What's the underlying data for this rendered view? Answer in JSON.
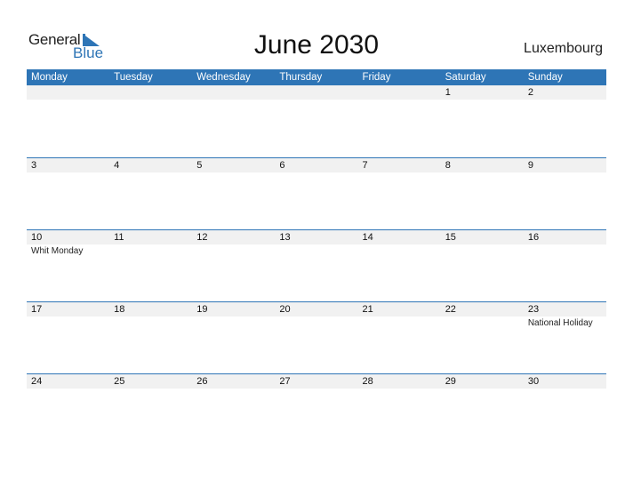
{
  "logo": {
    "text_general": "General",
    "text_blue": "Blue"
  },
  "title": "June 2030",
  "country": "Luxembourg",
  "weekdays": [
    "Monday",
    "Tuesday",
    "Wednesday",
    "Thursday",
    "Friday",
    "Saturday",
    "Sunday"
  ],
  "weeks": [
    [
      {
        "day": ""
      },
      {
        "day": ""
      },
      {
        "day": ""
      },
      {
        "day": ""
      },
      {
        "day": ""
      },
      {
        "day": "1"
      },
      {
        "day": "2"
      }
    ],
    [
      {
        "day": "3"
      },
      {
        "day": "4"
      },
      {
        "day": "5"
      },
      {
        "day": "6"
      },
      {
        "day": "7"
      },
      {
        "day": "8"
      },
      {
        "day": "9"
      }
    ],
    [
      {
        "day": "10",
        "event": "Whit Monday"
      },
      {
        "day": "11"
      },
      {
        "day": "12"
      },
      {
        "day": "13"
      },
      {
        "day": "14"
      },
      {
        "day": "15"
      },
      {
        "day": "16"
      }
    ],
    [
      {
        "day": "17"
      },
      {
        "day": "18"
      },
      {
        "day": "19"
      },
      {
        "day": "20"
      },
      {
        "day": "21"
      },
      {
        "day": "22"
      },
      {
        "day": "23",
        "event": "National Holiday"
      }
    ],
    [
      {
        "day": "24"
      },
      {
        "day": "25"
      },
      {
        "day": "26"
      },
      {
        "day": "27"
      },
      {
        "day": "28"
      },
      {
        "day": "29"
      },
      {
        "day": "30"
      }
    ]
  ],
  "colors": {
    "accent": "#2e75b6",
    "band": "#f1f1f1"
  }
}
